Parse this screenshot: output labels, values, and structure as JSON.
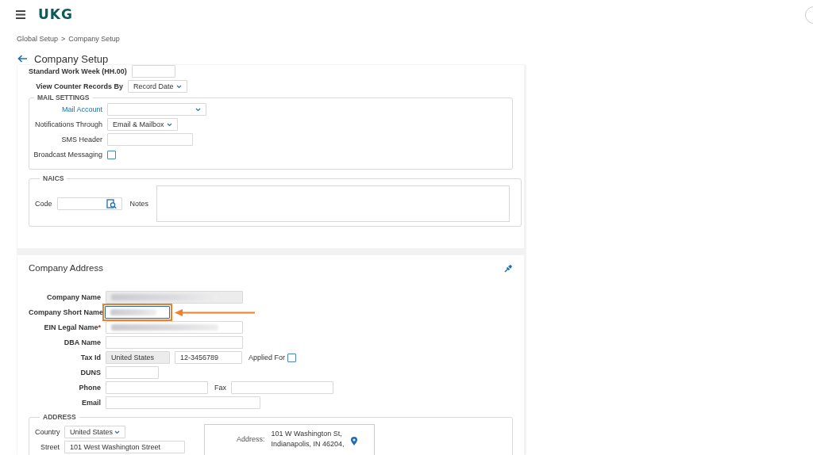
{
  "header": {
    "logo": "UKG"
  },
  "breadcrumb": {
    "items": [
      "Global Setup",
      "Company Setup"
    ],
    "separator": ">"
  },
  "page_title": "Company Setup",
  "settings_card": {
    "rows": [
      {
        "label": "Standard Work Week (HH.00)",
        "kind": "text"
      },
      {
        "label": "View Counter Records By",
        "kind": "select",
        "value": "Record Date"
      }
    ],
    "mail_settings": {
      "legend": "MAIL SETTINGS",
      "rows": [
        {
          "label": "Mail Account",
          "link": true,
          "kind": "select"
        },
        {
          "label": "Notifications Through",
          "link": false,
          "kind": "select",
          "value": "Email & Mailbox"
        },
        {
          "label": "SMS Header",
          "link": false,
          "kind": "text"
        },
        {
          "label": "Broadcast Messaging",
          "link": false,
          "kind": "checkbox",
          "checked": false
        }
      ]
    },
    "naics": {
      "legend": "NAICS",
      "code_label": "Code",
      "notes_label": "Notes"
    }
  },
  "company_address": {
    "title": "Company Address",
    "rows": [
      {
        "label": "Company Name",
        "fields": [
          {
            "kind": "text",
            "readonly": true,
            "redacted": true
          }
        ]
      },
      {
        "label": "Company Short Name",
        "fields": [
          {
            "kind": "text",
            "readonly": false,
            "redacted": true,
            "focused": true,
            "highlighted": true
          }
        ]
      },
      {
        "label": "EIN Legal Name",
        "required_mark": "*",
        "fields": [
          {
            "kind": "text",
            "readonly": false,
            "redacted": true
          }
        ]
      },
      {
        "label": "DBA Name",
        "fields": [
          {
            "kind": "text",
            "readonly": false
          }
        ]
      },
      {
        "label": "Tax Id",
        "fields": [
          {
            "kind": "text",
            "readonly": true,
            "value": "United States"
          },
          {
            "kind": "text",
            "readonly": false,
            "value": "12-3456789"
          },
          {
            "kind": "checkbox",
            "label": "Applied For",
            "checked": false
          }
        ]
      },
      {
        "label": "DUNS",
        "fields": [
          {
            "kind": "text",
            "readonly": false
          }
        ]
      },
      {
        "label": "Phone",
        "fields": [
          {
            "kind": "text",
            "readonly": false
          },
          {
            "kind": "text",
            "readonly": false,
            "label": "Fax"
          }
        ]
      },
      {
        "label": "Email",
        "fields": [
          {
            "kind": "text",
            "readonly": false
          }
        ]
      }
    ],
    "address": {
      "legend": "ADDRESS",
      "country_label": "Country",
      "country": "United States",
      "street_label": "Street",
      "street": "101 West Washington Street",
      "map_label": "Address:",
      "map_lines": [
        "101 W Washington St,",
        "Indianapolis, IN 46204,"
      ]
    }
  }
}
